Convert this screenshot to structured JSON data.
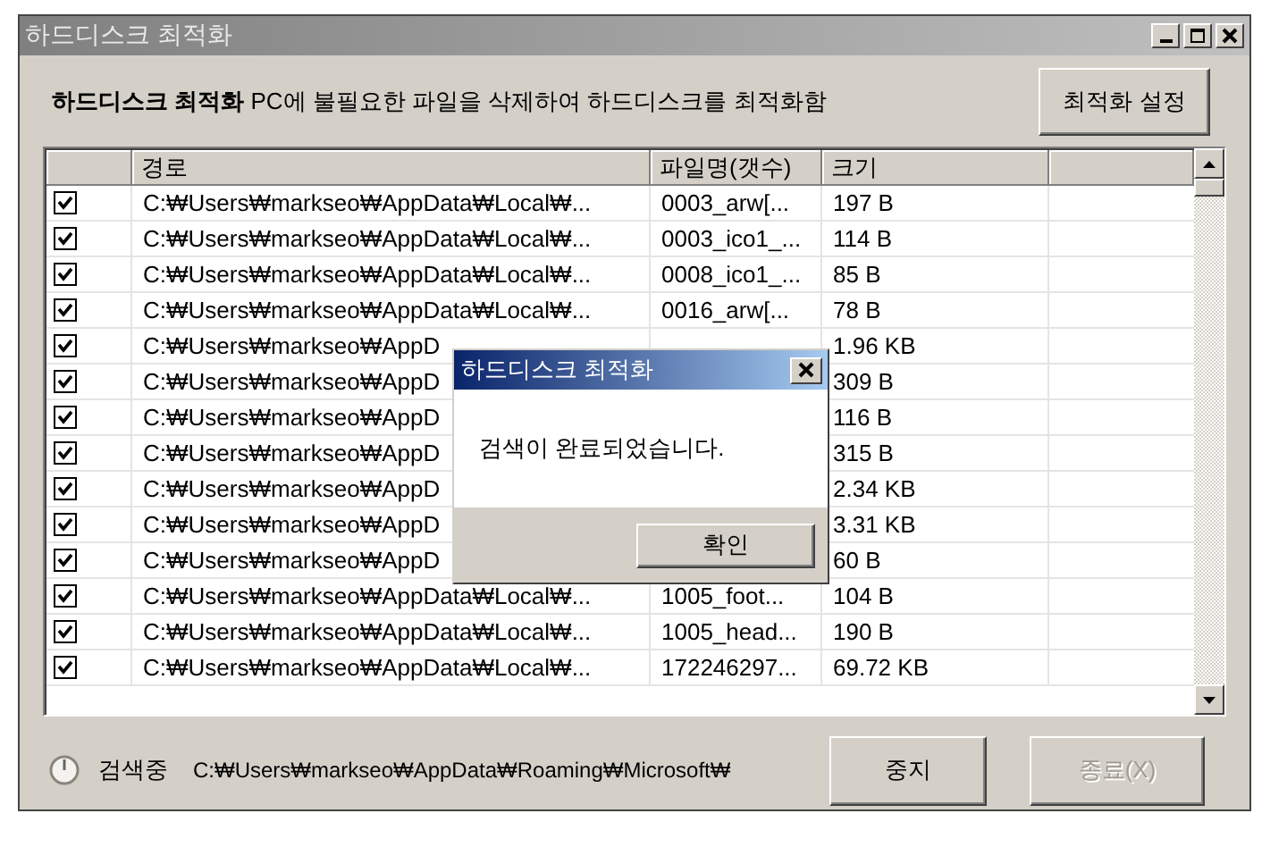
{
  "window": {
    "title": "하드디스크 최적화"
  },
  "header": {
    "text": "**하드디스크 최적화** PC에 불필요한 파일을 삭제하여 하드디스크를 최적화함",
    "settings_button": "최적화 설정"
  },
  "table": {
    "columns": [
      "경로",
      "파일명(갯수)",
      "크기"
    ],
    "rows": [
      {
        "checked": true,
        "path": "C:₩Users₩markseo₩AppData₩Local₩...",
        "filename": "0003_arw[...",
        "size": "197 B"
      },
      {
        "checked": true,
        "path": "C:₩Users₩markseo₩AppData₩Local₩...",
        "filename": "0003_ico1_...",
        "size": "114 B"
      },
      {
        "checked": true,
        "path": "C:₩Users₩markseo₩AppData₩Local₩...",
        "filename": "0008_ico1_...",
        "size": "85 B"
      },
      {
        "checked": true,
        "path": "C:₩Users₩markseo₩AppData₩Local₩...",
        "filename": "0016_arw[...",
        "size": "78 B"
      },
      {
        "checked": true,
        "path": "C:₩Users₩markseo₩AppD",
        "size": "1.96 KB"
      },
      {
        "checked": true,
        "path": "C:₩Users₩markseo₩AppD",
        "size": "309 B"
      },
      {
        "checked": true,
        "path": "C:₩Users₩markseo₩AppD",
        "size": "116 B"
      },
      {
        "checked": true,
        "path": "C:₩Users₩markseo₩AppD",
        "size": "315 B"
      },
      {
        "checked": true,
        "path": "C:₩Users₩markseo₩AppD",
        "size": "2.34 KB"
      },
      {
        "checked": true,
        "path": "C:₩Users₩markseo₩AppD",
        "size": "3.31 KB"
      },
      {
        "checked": true,
        "path": "C:₩Users₩markseo₩AppD",
        "size": "60 B"
      },
      {
        "checked": true,
        "path": "C:₩Users₩markseo₩AppData₩Local₩...",
        "filename": "1005_foot...",
        "size": "104 B"
      },
      {
        "checked": true,
        "path": "C:₩Users₩markseo₩AppData₩Local₩...",
        "filename": "1005_head...",
        "size": "190 B"
      },
      {
        "checked": true,
        "path": "C:₩Users₩markseo₩AppData₩Local₩...",
        "filename": "172246297...",
        "size": "69.72 KB"
      }
    ]
  },
  "status": {
    "label": "검색중",
    "path": "C:₩Users₩markseo₩AppData₩Roaming₩Microsoft₩"
  },
  "buttons": [
    {
      "label": "중지",
      "disabled": false
    },
    {
      "label": "종료(X)",
      "disabled": true
    }
  ],
  "dialog": {
    "title": "하드디스크 최적화",
    "message": "검색이 완료되었습니다.",
    "button": "확인"
  }
}
